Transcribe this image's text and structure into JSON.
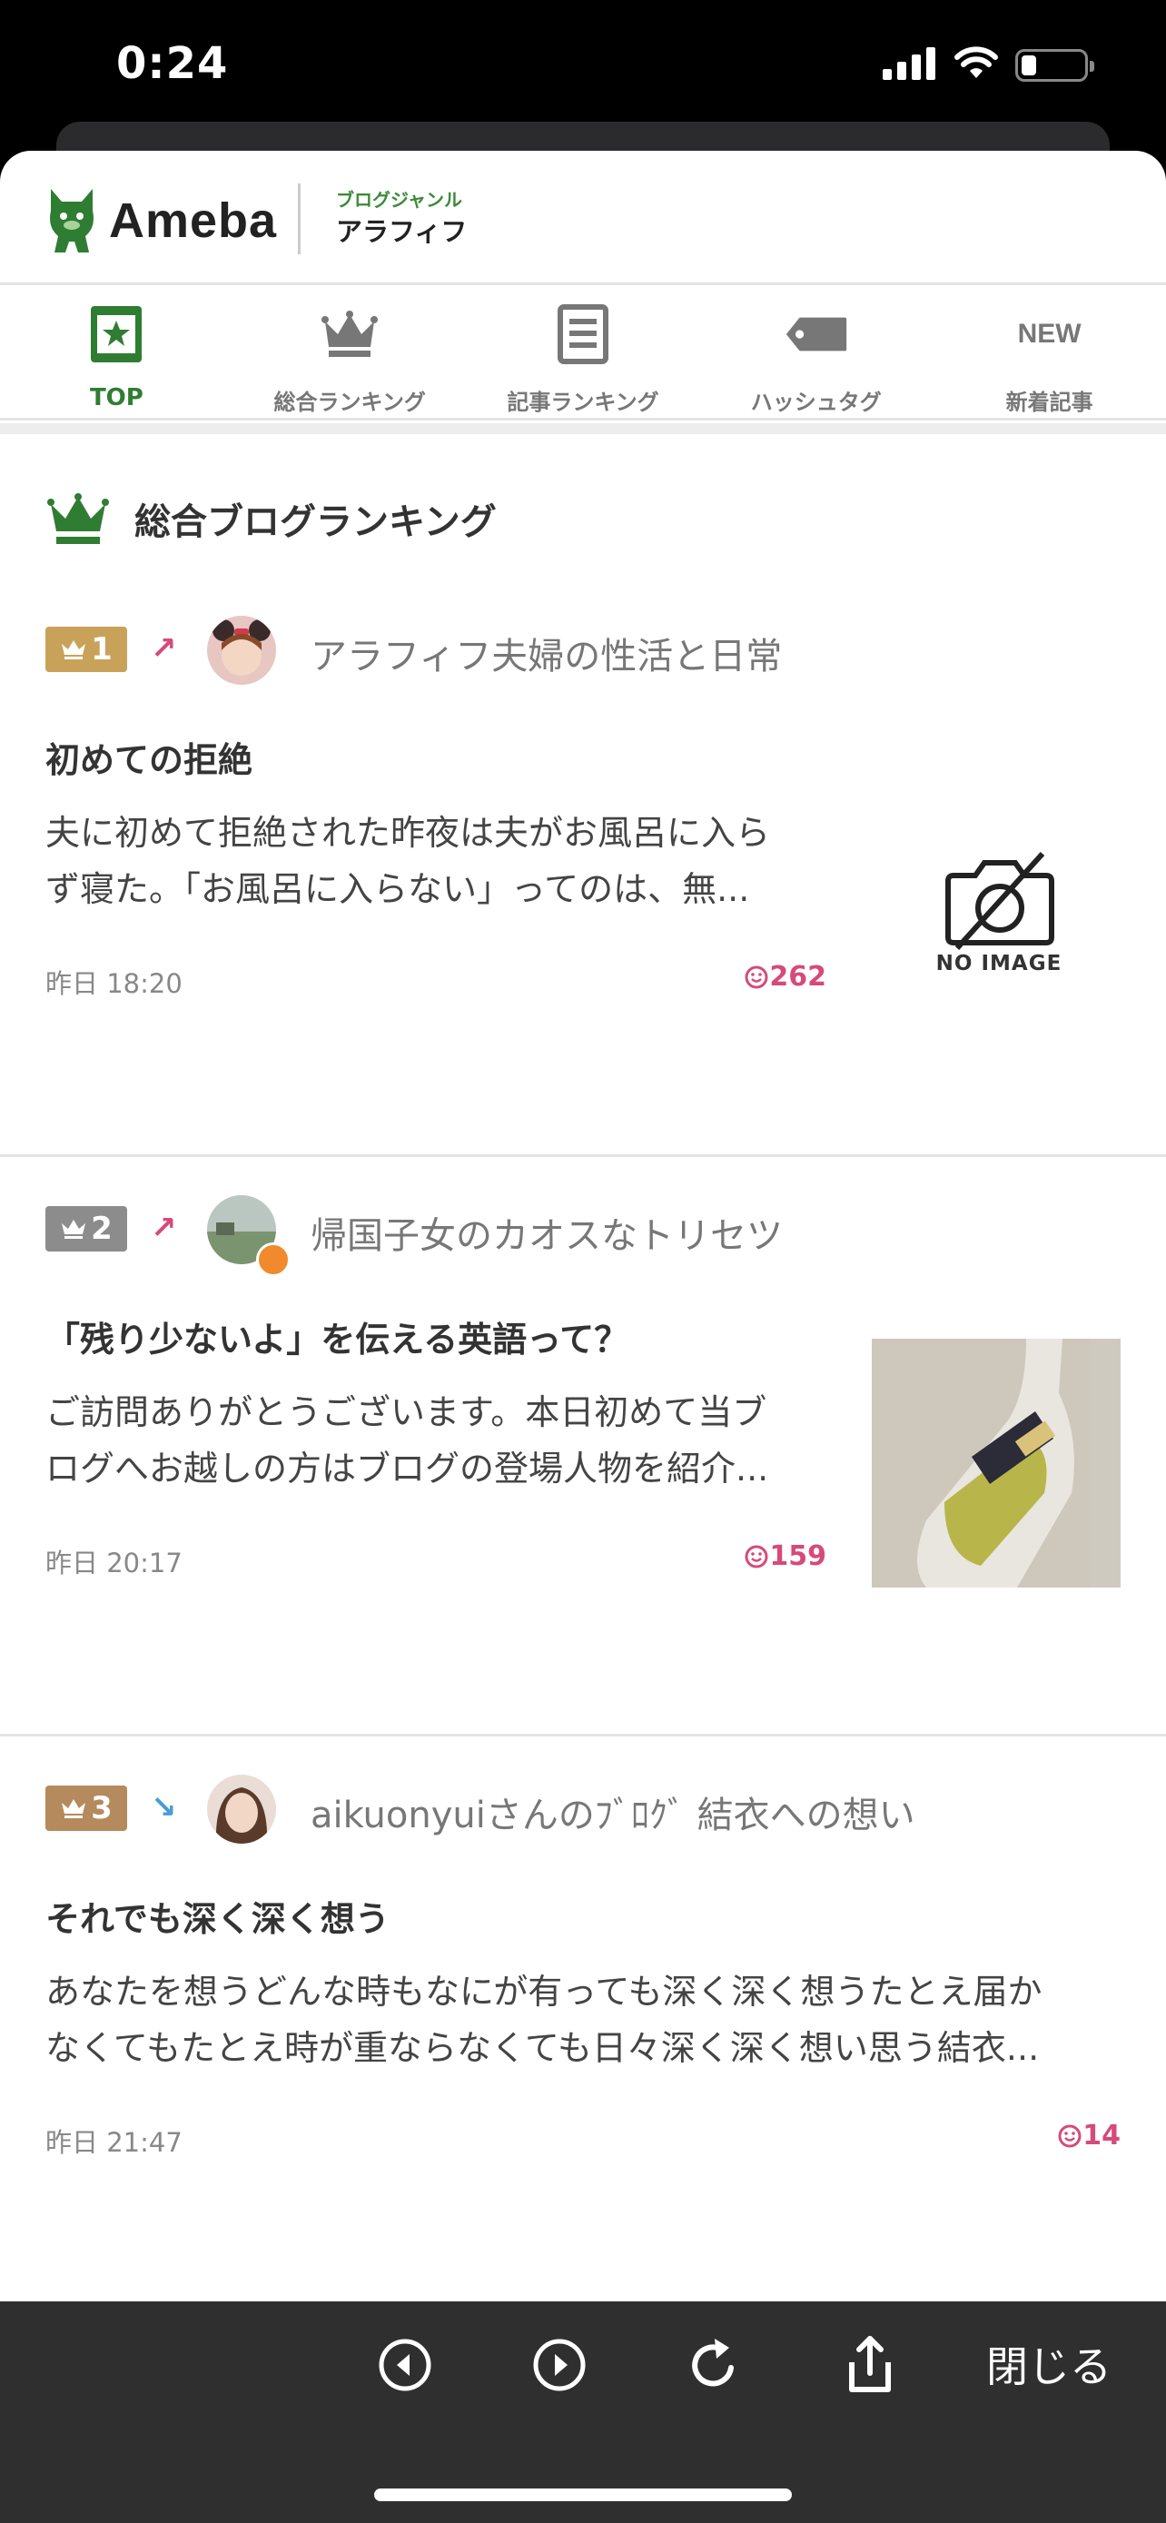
{
  "status_bar": {
    "time": "0:24"
  },
  "header": {
    "logo_text": "Ameba",
    "genre_label": "ブログジャンル",
    "genre_name": "アラフィフ"
  },
  "tabs": [
    {
      "label": "TOP",
      "icon": "star-card-icon",
      "active": true
    },
    {
      "label": "総合ランキング",
      "icon": "crown-icon",
      "active": false
    },
    {
      "label": "記事ランキング",
      "icon": "article-icon",
      "active": false
    },
    {
      "label": "ハッシュタグ",
      "icon": "tag-icon",
      "active": false
    },
    {
      "label": "新着記事",
      "icon": "new-icon",
      "icon_text": "NEW",
      "active": false
    }
  ],
  "section": {
    "title": "総合ブログランキング"
  },
  "entries": [
    {
      "rank": "1",
      "trend": "↗",
      "blog_name": "アラフィフ夫婦の性活と日常",
      "title": "初めての拒絶",
      "excerpt_line1": "夫に初めて拒絶された昨夜は夫がお風呂に入ら",
      "excerpt_line2": "ず寝た。「お風呂に入らない」ってのは、無...",
      "time": "昨日 18:20",
      "likes": "262",
      "no_image_label": "NO IMAGE"
    },
    {
      "rank": "2",
      "trend": "↗",
      "blog_name": "帰国子女のカオスなトリセツ",
      "title": "「残り少ないよ」を伝える英語って？",
      "excerpt_line1": "ご訪問ありがとうございます。本日初めて当ブ",
      "excerpt_line2": "ログへお越しの方はブログの登場人物を紹介...",
      "time": "昨日 20:17",
      "likes": "159"
    },
    {
      "rank": "3",
      "trend": "↘",
      "blog_name": "aikuonyuiさんのﾌﾞﾛｸﾞ 結衣への想い",
      "title": "それでも深く深く想う",
      "excerpt_line1": "あなたを想うどんな時もなにが有っても深く深く想うたとえ届か",
      "excerpt_line2": "なくてもたとえ時が重ならなくても日々深く深く想い思う結衣...",
      "time": "昨日 21:47",
      "likes": "14"
    }
  ],
  "toolbar": {
    "close_label": "閉じる"
  },
  "colors": {
    "brand_green": "#2f7d32",
    "rank1": "#c9a25a",
    "rank2": "#8c8c8c",
    "rank3": "#b58a5c",
    "trend_up": "#d64a7a",
    "trend_down": "#4a9bd6",
    "likes": "#d64a7a"
  }
}
